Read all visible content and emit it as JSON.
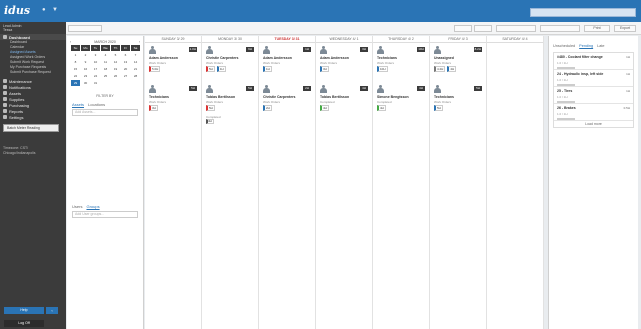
{
  "app": {
    "logo": "idus",
    "top_icons": [
      "user-icon",
      "chevron-down-icon"
    ]
  },
  "sidebar": {
    "user_line1": "Lead Admin",
    "user_line2": "Tessa",
    "sections": [
      {
        "label": "Dashboard",
        "icon": "dashboard-icon",
        "active": true
      },
      {
        "label": "Maintenance",
        "icon": "wrench-icon"
      },
      {
        "label": "Notifications",
        "icon": "bell-icon"
      },
      {
        "label": "Assets",
        "icon": "box-icon"
      },
      {
        "label": "Supplies",
        "icon": "supplies-icon"
      },
      {
        "label": "Purchasing",
        "icon": "cart-icon"
      },
      {
        "label": "Reports",
        "icon": "report-icon"
      },
      {
        "label": "Settings",
        "icon": "gear-icon"
      }
    ],
    "dashboard_sub": [
      "Dashboard",
      "Calendar",
      "Assigned Assets",
      "Assigned Work Orders",
      "Submit Work Request",
      "My Purchase Requests",
      "Submit Purchase Request"
    ],
    "batch_label": "Batch Meter Reading",
    "time_line1": "Timezone: CST/",
    "time_line2": "Chicago/Indianapolis",
    "bottom_btn": "Help",
    "logout": "Log Off"
  },
  "toolbar": {
    "print": "Print",
    "export": "Export"
  },
  "calendar": {
    "month_label": "MARCH 2020",
    "prev": "‹",
    "next": "›",
    "dow": [
      "Su",
      "Mo",
      "Tu",
      "We",
      "Th",
      "Fr",
      "Sa"
    ],
    "days": [
      "1",
      "2",
      "3",
      "4",
      "5",
      "6",
      "7",
      "8",
      "9",
      "10",
      "11",
      "12",
      "13",
      "14",
      "15",
      "16",
      "17",
      "18",
      "19",
      "20",
      "21",
      "22",
      "23",
      "24",
      "25",
      "26",
      "27",
      "28",
      "29",
      "30",
      "31"
    ],
    "selected": "29"
  },
  "filters": {
    "title": "FILTER BY",
    "tab_assets": "Assets",
    "tab_locations": "Locations",
    "asset_placeholder": "Add Assets...",
    "tab_users": "Users",
    "tab_groups": "Groups",
    "user_placeholder": "Add User groups..."
  },
  "board": {
    "columns": [
      {
        "head": "SUNDAY 3/ 29",
        "today": false
      },
      {
        "head": "MONDAY 3/ 30",
        "today": false
      },
      {
        "head": "TUESDAY 3/ 31",
        "today": true
      },
      {
        "head": "WEDNESDAY 4/ 1",
        "today": false
      },
      {
        "head": "THURSDAY 4/ 2",
        "today": false
      },
      {
        "head": "FRIDAY 4/ 3",
        "today": false
      },
      {
        "head": "SATURDAY 4/ 4",
        "today": false
      }
    ],
    "cards": [
      [
        {
          "name": "Adam Andersson",
          "sub": "Work Orders",
          "count": "1.0H",
          "chips": [
            {
              "t": "5.0H",
              "c": "red"
            }
          ]
        },
        {
          "name": "Technicians",
          "sub": "Work Orders",
          "count": "5H",
          "chips": [
            {
              "t": "3H",
              "c": "red"
            }
          ]
        }
      ],
      [
        {
          "name": "Christie Carpenters",
          "sub": "Work Orders",
          "count": "9H",
          "chips": [
            {
              "t": "5H",
              "c": "red"
            },
            {
              "t": "1H",
              "c": "blue"
            }
          ]
        },
        {
          "name": "Tobias Bertilsson",
          "sub": "Work Orders",
          "count": "5H",
          "chips": [
            {
              "t": "5H",
              "c": "red"
            }
          ],
          "extra": "Completed",
          "extra_chip": "4H"
        }
      ],
      [
        {
          "name": "Adam Andersson",
          "sub": "Work Orders",
          "count": "1H",
          "chips": [
            {
              "t": "1H",
              "c": "blue"
            }
          ]
        },
        {
          "name": "Christie Carpenters",
          "sub": "Work Orders",
          "count": "2H",
          "chips": [
            {
              "t": "2H",
              "c": "blue"
            }
          ]
        }
      ],
      [
        {
          "name": "Adam Andersson",
          "sub": "Work Orders",
          "count": "3H",
          "chips": [
            {
              "t": "3H",
              "c": "blue"
            }
          ]
        },
        {
          "name": "Tobias Bertilsson",
          "sub": "Completed",
          "count": "4H",
          "chips": [
            {
              "t": "4H",
              "c": "green"
            }
          ]
        }
      ],
      [
        {
          "name": "Technicians",
          "sub": "Work Orders",
          "count": "10H",
          "chips": [
            {
              "t": "10H",
              "c": "blue"
            }
          ]
        },
        {
          "name": "Simone Bengtsson",
          "sub": "Completed",
          "count": "4H",
          "chips": [
            {
              "t": "4H",
              "c": "green"
            }
          ]
        }
      ],
      [
        {
          "name": "Unassigned",
          "sub": "Work Orders",
          "count": "8.2H",
          "chips": [
            {
              "t": "4.2H",
              "c": "gray"
            },
            {
              "t": "4H",
              "c": "blue"
            }
          ]
        },
        {
          "name": "Technicians",
          "sub": "Work Orders",
          "count": "5H",
          "chips": [
            {
              "t": "5H",
              "c": "blue"
            }
          ]
        }
      ],
      []
    ]
  },
  "rightpanel": {
    "tab_unscheduled": "Unscheduled",
    "tab_pending": "Pending",
    "tab_late": "Late",
    "items": [
      {
        "title": "#480 - Coolant filter change",
        "time": "1H",
        "sub": "1.0 / 1H"
      },
      {
        "title": "24 - Hydraulic insp, left side",
        "time": "1H",
        "sub": "1.0 / 1H"
      },
      {
        "title": "25 - Tires",
        "time": "1H",
        "sub": "1.0 / 1H"
      },
      {
        "title": "26 - Brakes",
        "time": "0.5H",
        "sub": "1.0 / 1H"
      }
    ],
    "load_more": "Load more"
  }
}
